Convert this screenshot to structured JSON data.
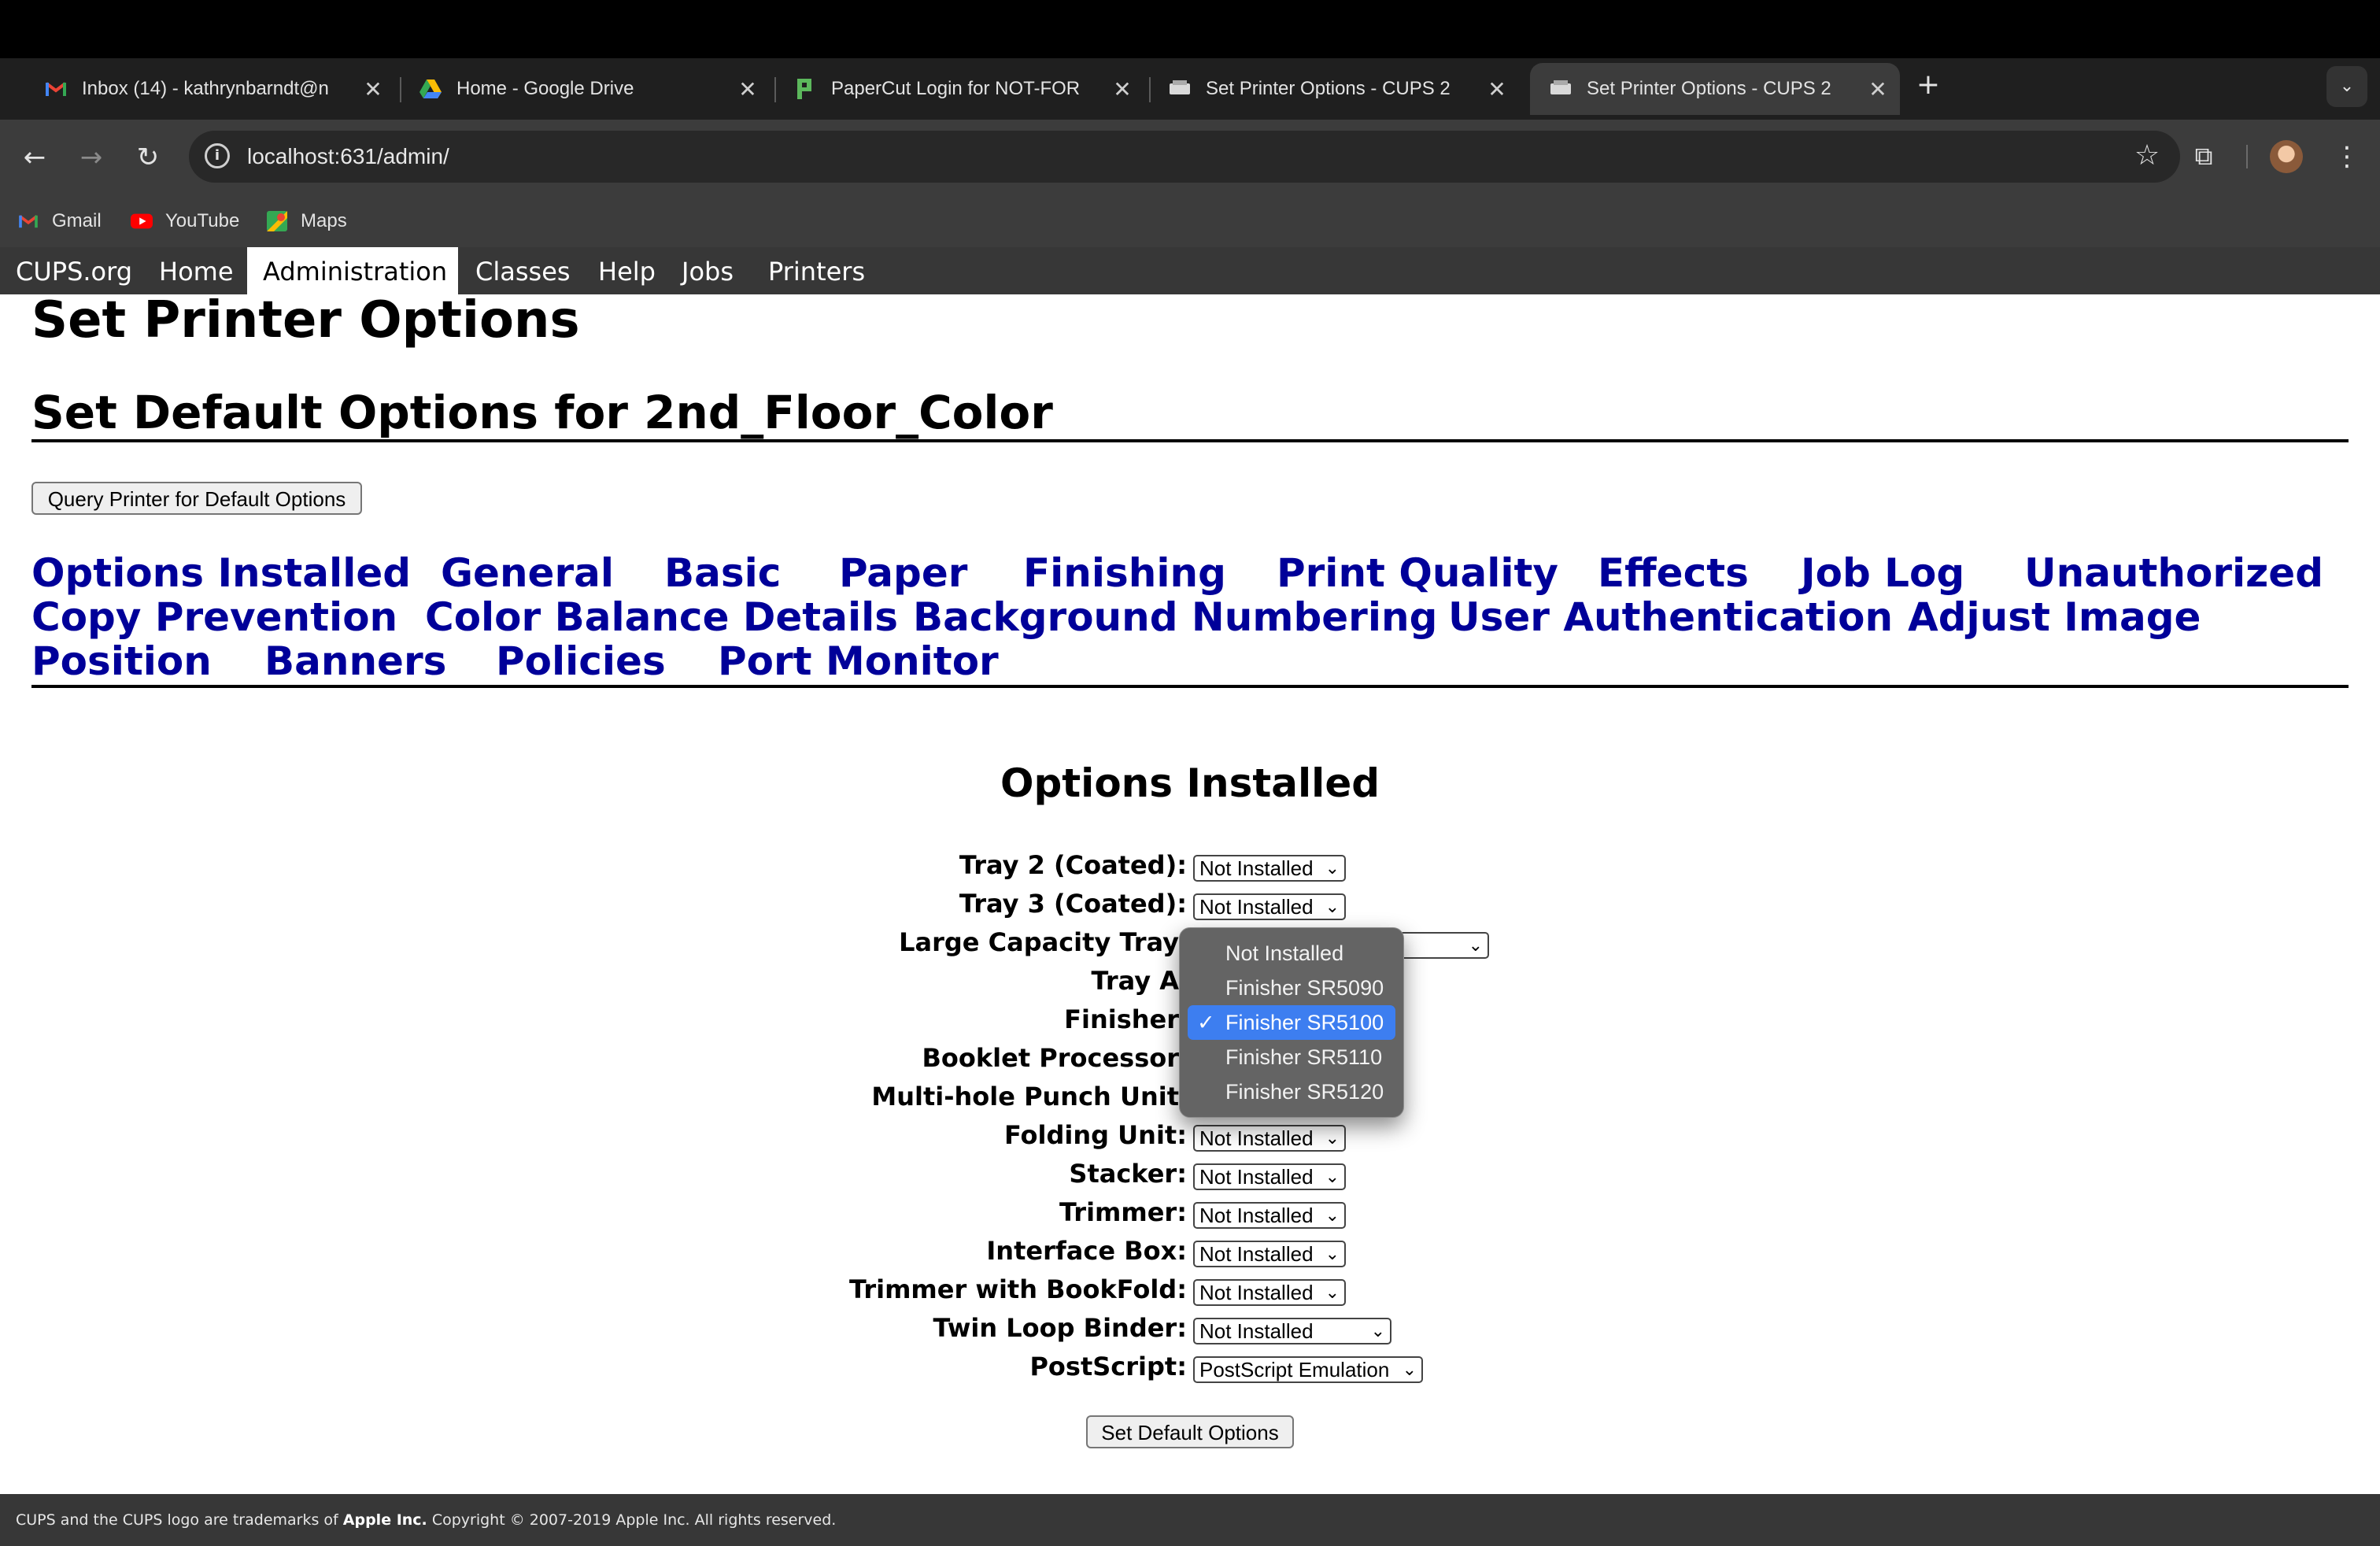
{
  "browser": {
    "tabs": [
      {
        "title": "Inbox (14) - kathrynbarndt@n",
        "icon": "gmail-icon"
      },
      {
        "title": "Home - Google Drive",
        "icon": "google-drive-icon"
      },
      {
        "title": "PaperCut Login for NOT-FOR",
        "icon": "papercut-icon"
      },
      {
        "title": "Set Printer Options - CUPS 2",
        "icon": "cups-icon"
      },
      {
        "title": "Set Printer Options - CUPS 2",
        "icon": "cups-icon",
        "active": true
      }
    ],
    "close_glyph": "✕",
    "new_tab_glyph": "+",
    "address": "localhost:631/admin/",
    "bookmarks": [
      {
        "label": "Gmail",
        "icon": "gmail-icon"
      },
      {
        "label": "YouTube",
        "icon": "youtube-icon"
      },
      {
        "label": "Maps",
        "icon": "maps-icon"
      }
    ]
  },
  "cups_nav": {
    "items": [
      "CUPS.org",
      "Home",
      "Administration",
      "Classes",
      "Help",
      "Jobs",
      "Printers"
    ],
    "active": "Administration"
  },
  "page": {
    "title": "Set Printer Options",
    "subtitle": "Set Default Options for 2nd_Floor_Color",
    "query_button": "Query Printer for Default Options",
    "sections": [
      "Options Installed",
      "General",
      "Basic",
      "Paper",
      "Finishing",
      "Print Quality",
      "Effects",
      "Job Log",
      "Unauthorized",
      "Copy Prevention",
      "Color Balance Details",
      "Background Numbering",
      "User Authentication",
      "Adjust Image",
      "Position",
      "Banners",
      "Policies",
      "Port Monitor"
    ],
    "options_heading": "Options Installed",
    "options": [
      {
        "label": "Tray 2 (Coated):",
        "value": "Not Installed"
      },
      {
        "label": "Tray 3 (Coated):",
        "value": "Not Installed"
      },
      {
        "label": "Large Capacity Tray",
        "value": ""
      },
      {
        "label": "Tray A",
        "value": ""
      },
      {
        "label": "Finisher",
        "value": ""
      },
      {
        "label": "Booklet Processor",
        "value": ""
      },
      {
        "label": "Multi-hole Punch Unit",
        "value": ""
      },
      {
        "label": "Folding Unit:",
        "value": "Not Installed"
      },
      {
        "label": "Stacker:",
        "value": "Not Installed"
      },
      {
        "label": "Trimmer:",
        "value": "Not Installed"
      },
      {
        "label": "Interface Box:",
        "value": "Not Installed"
      },
      {
        "label": "Trimmer with BookFold:",
        "value": "Not Installed"
      },
      {
        "label": "Twin Loop Binder:",
        "value": "Not Installed"
      },
      {
        "label": "PostScript:",
        "value": "PostScript Emulation"
      }
    ],
    "finisher_dropdown": {
      "options": [
        "Not Installed",
        "Finisher SR5090",
        "Finisher SR5100",
        "Finisher SR5110",
        "Finisher SR5120"
      ],
      "selected": "Finisher SR5100",
      "check_glyph": "✓"
    },
    "submit_button": "Set Default Options"
  },
  "footer": {
    "prefix": "CUPS and the CUPS logo are trademarks of ",
    "company": "Apple Inc.",
    "suffix": " Copyright © 2007-2019 Apple Inc. All rights reserved."
  },
  "colors": {
    "link": "#000099",
    "nav_bg": "#373737",
    "selection": "#3d7ef0"
  }
}
